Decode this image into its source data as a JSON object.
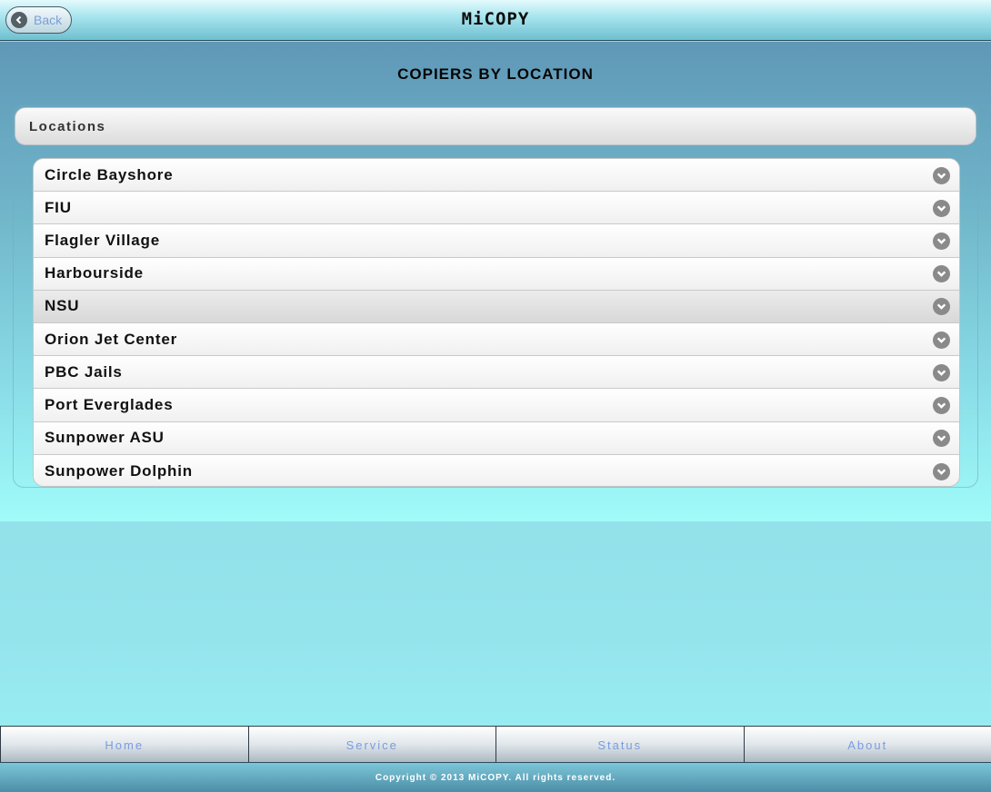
{
  "header": {
    "back_label": "Back",
    "app_title": "MiCOPY"
  },
  "page": {
    "title": "COPIERS BY LOCATION"
  },
  "collapsible": {
    "heading": "Locations",
    "items": [
      {
        "label": "Circle Bayshore"
      },
      {
        "label": "FIU"
      },
      {
        "label": "Flagler Village"
      },
      {
        "label": "Harbourside"
      },
      {
        "label": "NSU"
      },
      {
        "label": "Orion Jet Center"
      },
      {
        "label": "PBC Jails"
      },
      {
        "label": "Port Everglades"
      },
      {
        "label": "Sunpower ASU"
      },
      {
        "label": "Sunpower Dolphin"
      }
    ]
  },
  "footer": {
    "nav": [
      {
        "label": "Home"
      },
      {
        "label": "Service"
      },
      {
        "label": "Status"
      },
      {
        "label": "About"
      }
    ],
    "copyright": "Copyright © 2013 MiCOPY. All rights reserved."
  },
  "icons": {
    "back": "chevron-left-circle-icon",
    "row_chevron": "chevron-down-circle-icon"
  },
  "colors": {
    "link_blue": "#7b9be0",
    "icon_gray": "#8a8a8a"
  }
}
